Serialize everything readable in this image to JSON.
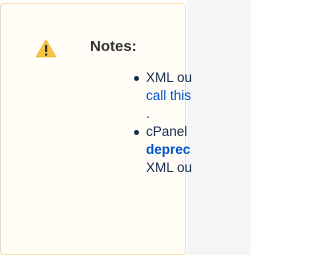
{
  "note": {
    "title": "Notes:",
    "icon": "warning-icon",
    "accent_color": "#f6c342",
    "items": [
      {
        "line1": "XML ou",
        "link": "call this",
        "trailing": "."
      },
      {
        "line1": "cPanel",
        "bold_link": "deprec",
        "line3": "XML ou"
      }
    ]
  }
}
